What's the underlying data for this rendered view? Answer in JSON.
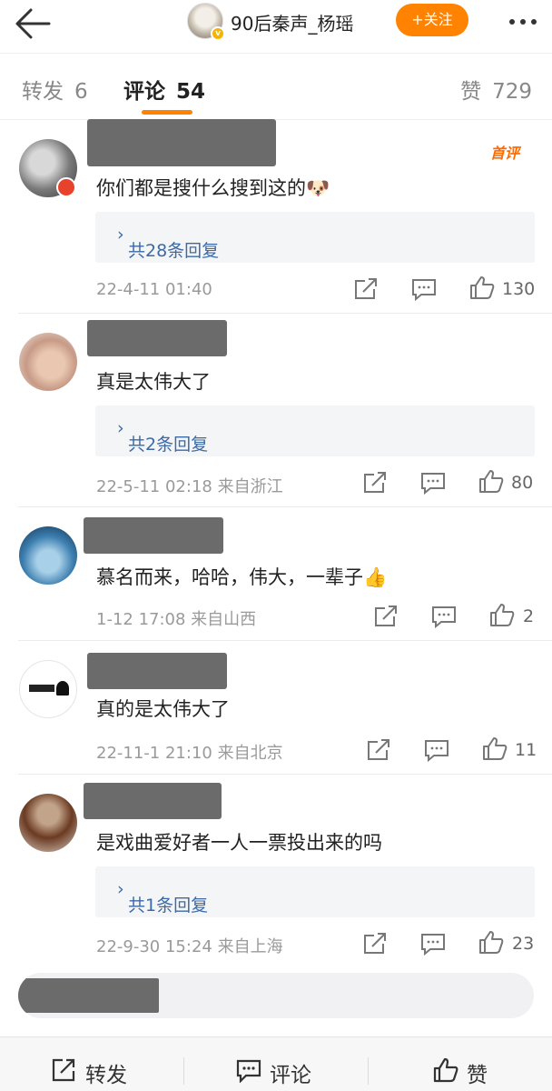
{
  "header": {
    "title": "90后秦声_杨瑶",
    "follow_label": "+关注",
    "verified_badge": "v"
  },
  "tabs": {
    "forward_label": "转发",
    "forward_count": "6",
    "comment_label": "评论",
    "comment_count": "54",
    "like_label": "赞",
    "like_count": "729"
  },
  "comments": [
    {
      "text": "你们都是搜什么搜到这的",
      "emoji": "🐶",
      "first_tag": "首评",
      "replies_label": "共28条回复",
      "meta": "22-4-11  01:40",
      "likes": "130"
    },
    {
      "text": "真是太伟大了",
      "replies_label": "共2条回复",
      "meta": "22-5-11  02:18  来自浙江",
      "likes": "80"
    },
    {
      "text": "慕名而来，哈哈，伟大，一辈子",
      "emoji": "👍",
      "meta": "1-12  17:08  来自山西",
      "likes": "2"
    },
    {
      "text": "真的是太伟大了",
      "meta": "22-11-1  21:10  来自北京",
      "likes": "11"
    },
    {
      "text": "是戏曲爱好者一人一票投出来的吗",
      "replies_label": "共1条回复",
      "meta": "22-9-30  15:24  来自上海",
      "likes": "23"
    }
  ],
  "bottom_bar": {
    "forward_label": "转发",
    "comment_label": "评论",
    "like_label": "赞"
  },
  "colors": {
    "accent": "#ff8200",
    "link": "#3b6aa7",
    "meta": "#9a9a9a"
  }
}
